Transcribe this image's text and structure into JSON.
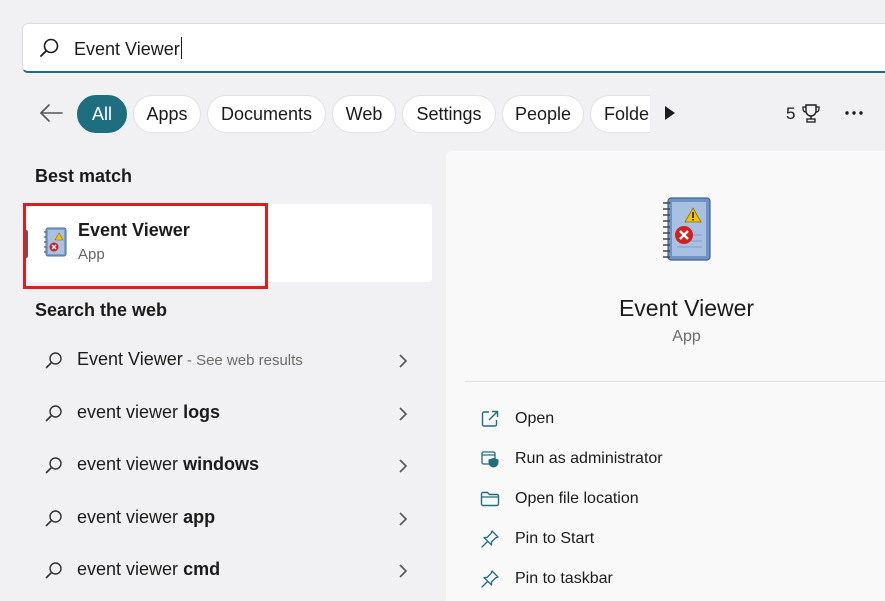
{
  "search": {
    "query": "Event Viewer",
    "icon": "search-icon"
  },
  "filters": {
    "tabs": [
      "All",
      "Apps",
      "Documents",
      "Web",
      "Settings",
      "People",
      "Folde"
    ],
    "active": "All",
    "count": "5",
    "accent_color": "#1f6e80"
  },
  "best_match": {
    "title": "Best match",
    "name": "Event Viewer",
    "type": "App"
  },
  "web": {
    "title": "Search the web",
    "items": [
      {
        "prefix": "Event Viewer",
        "bold": "",
        "suffix": " - See web results"
      },
      {
        "prefix": "event viewer ",
        "bold": "logs",
        "suffix": ""
      },
      {
        "prefix": "event viewer ",
        "bold": "windows",
        "suffix": ""
      },
      {
        "prefix": "event viewer ",
        "bold": "app",
        "suffix": ""
      },
      {
        "prefix": "event viewer ",
        "bold": "cmd",
        "suffix": ""
      }
    ]
  },
  "detail": {
    "name": "Event Viewer",
    "type": "App",
    "actions": [
      {
        "label": "Open",
        "icon": "open-external-icon"
      },
      {
        "label": "Run as administrator",
        "icon": "shield-icon"
      },
      {
        "label": "Open file location",
        "icon": "folder-icon"
      },
      {
        "label": "Pin to Start",
        "icon": "pin-icon"
      },
      {
        "label": "Pin to taskbar",
        "icon": "pin-icon"
      }
    ]
  },
  "highlight_color": "#e21c1c"
}
